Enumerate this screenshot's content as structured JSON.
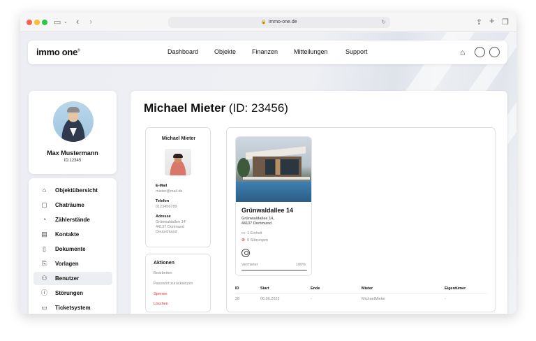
{
  "browser": {
    "url": "immo-one.de"
  },
  "brand": {
    "name": "immo one",
    "registered": "®"
  },
  "nav": {
    "items": [
      {
        "label": "Dashboard"
      },
      {
        "label": "Objekte"
      },
      {
        "label": "Finanzen"
      },
      {
        "label": "Mitteilungen"
      },
      {
        "label": "Support"
      }
    ]
  },
  "profile": {
    "name": "Max Mustermann",
    "id": "ID:12345"
  },
  "sidebar": {
    "items": [
      {
        "label": "Objektübersicht",
        "icon": "home-icon"
      },
      {
        "label": "Chaträume",
        "icon": "chat-icon"
      },
      {
        "label": "Zählerstände",
        "icon": "gauge-icon"
      },
      {
        "label": "Kontakte",
        "icon": "contacts-icon"
      },
      {
        "label": "Dokumente",
        "icon": "document-icon"
      },
      {
        "label": "Vorlagen",
        "icon": "template-icon"
      },
      {
        "label": "Benutzer",
        "icon": "users-icon",
        "active": true
      },
      {
        "label": "Störungen",
        "icon": "alert-icon"
      },
      {
        "label": "Ticketsystem",
        "icon": "ticket-icon"
      }
    ]
  },
  "page": {
    "title_name": "Michael Mieter",
    "title_id": "(ID: 23456)"
  },
  "tenant": {
    "name": "Michael Mieter",
    "email_label": "E-Mail",
    "email": "mieter@mail.de",
    "phone_label": "Telefon",
    "phone": "0123456789",
    "address_label": "Adresse",
    "address_line1": "Grünwaldallee 14",
    "address_line2": "44137 Dortmund",
    "address_line3": "Deutschland"
  },
  "actions": {
    "title": "Aktionen",
    "edit": "Bearbeiten",
    "reset_password": "Passwort zurücksetzen",
    "lock": "Sperren",
    "delete": "Löschen"
  },
  "property": {
    "title": "Grünwaldallee 14",
    "address_line1": "Grünwaldallee 14,",
    "address_line2": "44137 Dortmund",
    "units": "1 Einheit",
    "issues": "0 Störungen",
    "status_label": "Vermietet",
    "status_percent": "100%",
    "occupancy": 1.0
  },
  "table": {
    "headers": [
      "ID",
      "Start",
      "Ende",
      "Mieter",
      "Eigentümer"
    ],
    "rows": [
      [
        "28",
        "06.06.2022",
        "-",
        "MichaelMieter",
        "-"
      ]
    ]
  },
  "colors": {
    "danger": "#e0302a",
    "active_bg": "#eceef1"
  }
}
